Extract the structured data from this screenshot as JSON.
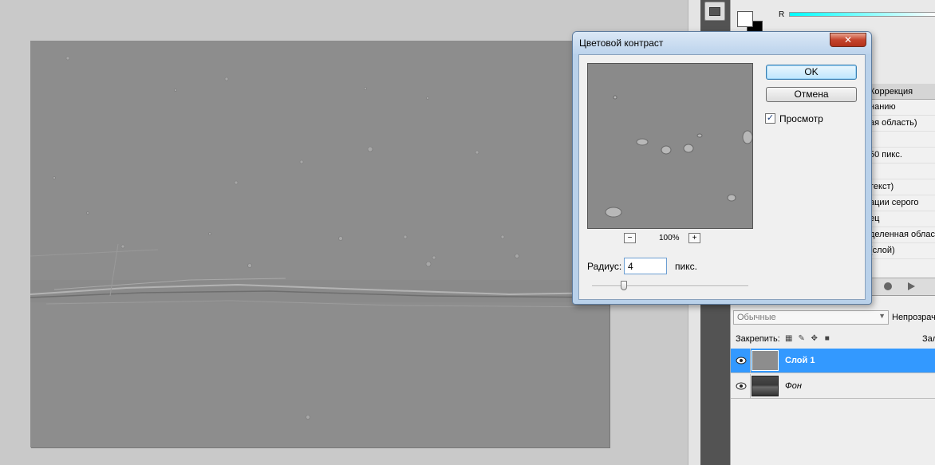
{
  "dialog": {
    "title": "Цветовой контраст",
    "close_glyph": "✕",
    "ok_label": "OK",
    "cancel_label": "Отмена",
    "preview_label": "Просмотр",
    "preview_checked": true,
    "zoom_out": "−",
    "zoom_in": "+",
    "zoom_level": "100%",
    "radius_label": "Радиус:",
    "radius_value": "4",
    "radius_unit": "пикс."
  },
  "color_panel": {
    "channel_r": "R",
    "foreground": "#ffffff",
    "background": "#000000"
  },
  "props_panel": {
    "tab_label": "Коррекция",
    "rows": [
      "нанию",
      "ая область)",
      "",
      "50 пикс.",
      "",
      "текст)",
      "ации серого",
      "ец",
      "деленная област",
      " (слой)"
    ]
  },
  "layers_panel": {
    "blend_mode": "Обычные",
    "opacity_label": "Непрозрачн",
    "lock_label": "Закрепить:",
    "fill_label": "Зал",
    "layers": [
      {
        "name": "Слой 1",
        "selected": true
      },
      {
        "name": "Фон",
        "selected": false
      }
    ]
  },
  "colors": {
    "selection": "#3399ff",
    "dialog_frame": "#b9d1ea",
    "canvas_gray": "#8d8d8d"
  }
}
